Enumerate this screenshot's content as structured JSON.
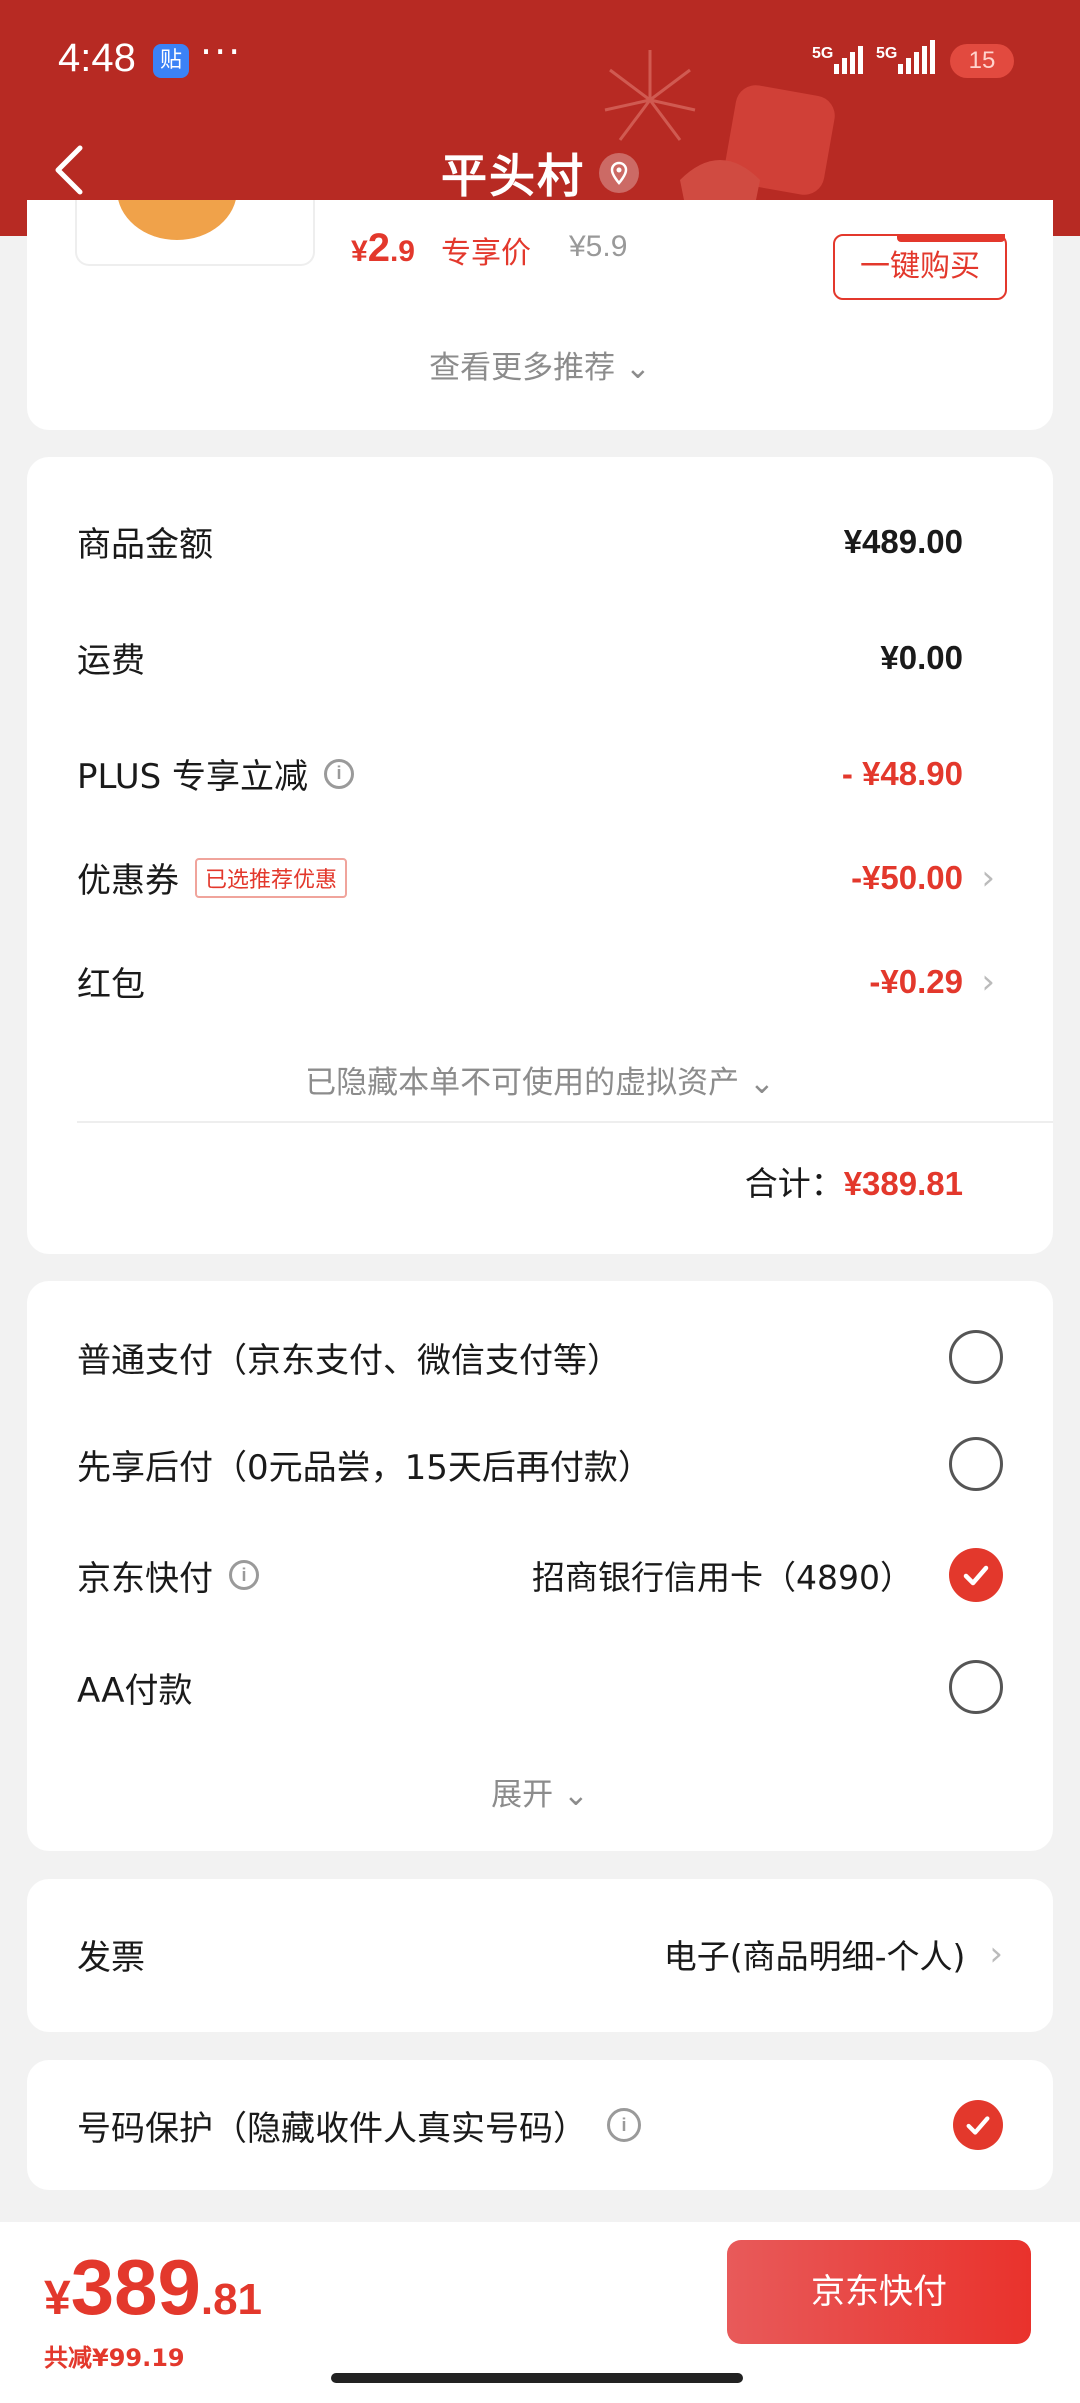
{
  "status_bar": {
    "time": "4:48",
    "app_badge": "贴",
    "more": "···",
    "battery": "15"
  },
  "header": {
    "title": "平头村"
  },
  "recommendation": {
    "price_symbol": "¥",
    "price_int": "2",
    "price_dec": ".9",
    "price_tag": "专享价",
    "original_price": "¥5.9",
    "buy_label": "一键购买",
    "more_label": "查看更多推荐 ⌄"
  },
  "summary": {
    "goods_label": "商品金额",
    "goods_value": "¥489.00",
    "shipping_label": "运费",
    "shipping_value": "¥0.00",
    "plus_label": "PLUS 专享立减",
    "plus_value": "- ¥48.90",
    "coupon_label": "优惠券",
    "coupon_badge": "已选推荐优惠",
    "coupon_value": "-¥50.00",
    "redpack_label": "红包",
    "redpack_value": "-¥0.29",
    "hidden_note": "已隐藏本单不可使用的虚拟资产 ⌄",
    "total_label": "合计：",
    "total_value": "¥389.81"
  },
  "payment": {
    "options": [
      {
        "label": "普通支付（京东支付、微信支付等）",
        "checked": false
      },
      {
        "label": "先享后付（0元品尝，15天后再付款）",
        "checked": false
      },
      {
        "label": "京东快付",
        "detail": "招商银行信用卡（4890）",
        "checked": true
      },
      {
        "label": "AA付款",
        "checked": false
      }
    ],
    "expand_label": "展开 ⌄"
  },
  "invoice": {
    "label": "发票",
    "value": "电子(商品明细-个人)"
  },
  "protection": {
    "label": "号码保护（隐藏收件人真实号码）",
    "checked": true
  },
  "bottom": {
    "yen": "¥",
    "price_int": "389",
    "price_dec": ".81",
    "saved": "共减¥99.19",
    "pay_button": "京东快付"
  },
  "colors": {
    "header": "#b72a23",
    "accent": "#e3382c"
  }
}
